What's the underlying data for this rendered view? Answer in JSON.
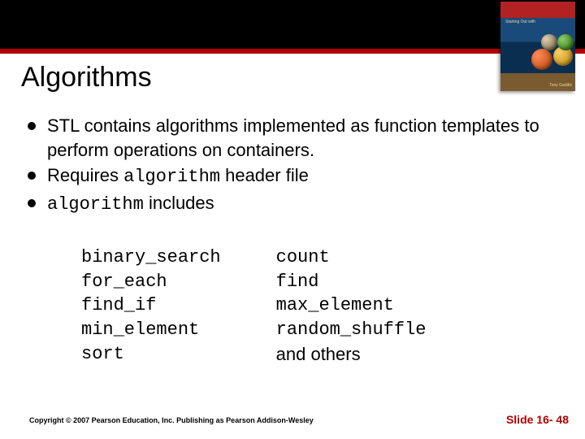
{
  "title": "Algorithms",
  "bullets": {
    "b1": "STL contains algorithms implemented as function templates to perform operations on containers.",
    "b2a": "Requires ",
    "b2b": "algorithm",
    "b2c": " header file",
    "b3a": "algorithm",
    "b3b": " includes"
  },
  "algos": {
    "left": {
      "r1": "binary_search",
      "r2": "for_each",
      "r3": "find_if",
      "r4": "min_element",
      "r5": "sort"
    },
    "right": {
      "r1": "count",
      "r2": "find",
      "r3": "max_element",
      "r4": "random_shuffle",
      "r5": "and others"
    }
  },
  "cover": {
    "line1": "Starting Out with",
    "line2": "Tony Gaddis"
  },
  "footer": {
    "left": "Copyright © 2007 Pearson Education, Inc. Publishing as Pearson Addison-Wesley",
    "right": "Slide 16- 48"
  }
}
